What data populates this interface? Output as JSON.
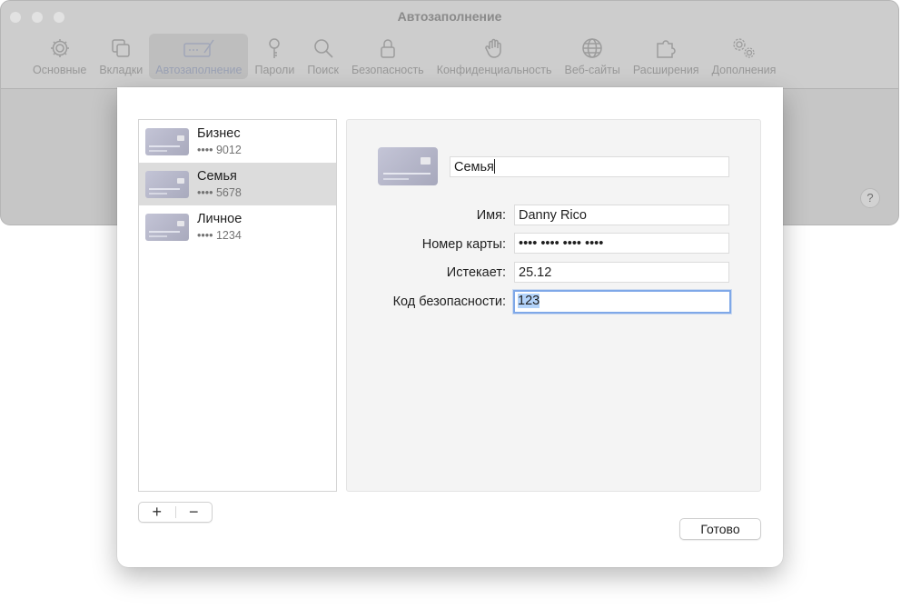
{
  "window": {
    "title": "Автозаполнение",
    "help_label": "?"
  },
  "toolbar": {
    "tabs": [
      {
        "label": "Основные",
        "icon": "gear-icon"
      },
      {
        "label": "Вкладки",
        "icon": "tabs-icon"
      },
      {
        "label": "Автозаполнение",
        "icon": "autofill-icon",
        "active": true
      },
      {
        "label": "Пароли",
        "icon": "key-icon"
      },
      {
        "label": "Поиск",
        "icon": "search-icon"
      },
      {
        "label": "Безопасность",
        "icon": "lock-icon"
      },
      {
        "label": "Конфиденциальность",
        "icon": "hand-icon"
      },
      {
        "label": "Веб-сайты",
        "icon": "globe-icon"
      },
      {
        "label": "Расширения",
        "icon": "puzzle-icon"
      },
      {
        "label": "Дополнения",
        "icon": "gears-icon"
      }
    ]
  },
  "cards": [
    {
      "name": "Бизнес",
      "number": "•••• 9012"
    },
    {
      "name": "Семья",
      "number": "•••• 5678",
      "selected": true
    },
    {
      "name": "Личное",
      "number": "•••• 1234"
    }
  ],
  "list_buttons": {
    "add": "+",
    "remove": "−"
  },
  "detail": {
    "card_description": "Семья",
    "fields": {
      "name": {
        "label": "Имя:",
        "value": "Danny Rico"
      },
      "number": {
        "label": "Номер карты:",
        "value": "•••• •••• •••• ••••"
      },
      "expires": {
        "label": "Истекает:",
        "value": "25.12"
      },
      "cvc": {
        "label": "Код безопасности:",
        "value": "123"
      }
    }
  },
  "done_label": "Готово",
  "colors": {
    "accent_focus": "#7fa8e8",
    "selection_row": "#dcdcdc",
    "card": "#b5b6c9"
  }
}
